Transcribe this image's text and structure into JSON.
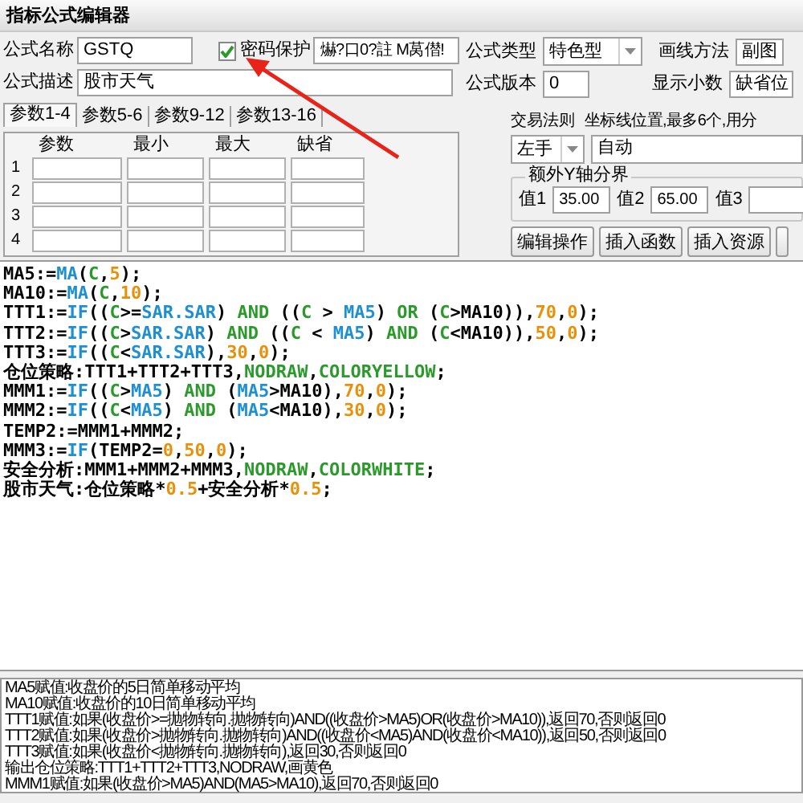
{
  "window": {
    "title": "指标公式编辑器"
  },
  "form": {
    "name_label": "公式名称",
    "name_value": "GSTQ",
    "password": {
      "label": "密码保护",
      "checked": true,
      "value": "爀?口0?註 M莴僣!"
    },
    "type_label": "公式类型",
    "type_value": "特色型",
    "draw_label": "画线方法",
    "draw_value": "副图",
    "desc_label": "公式描述",
    "desc_value": "股市天气",
    "version_label": "公式版本",
    "version_value": "0",
    "decimals_label": "显示小数",
    "decimals_value": "缺省位"
  },
  "tabs": [
    {
      "label": "参数1-4",
      "selected": true
    },
    {
      "label": "参数5-6",
      "selected": false
    },
    {
      "label": "参数9-12",
      "selected": false
    },
    {
      "label": "参数13-16",
      "selected": false
    }
  ],
  "params": {
    "columns": [
      "参数",
      "最小",
      "最大",
      "缺省"
    ],
    "rows": [
      "1",
      "2",
      "3",
      "4"
    ]
  },
  "trade": {
    "label": "交易法则",
    "value": "左手"
  },
  "axis": {
    "label": "坐标线位置,最多6个,用分",
    "value": "自动"
  },
  "extra_y": {
    "title": "额外Y轴分界",
    "values": [
      {
        "label": "值1",
        "value": "35.00"
      },
      {
        "label": "值2",
        "value": "65.00"
      },
      {
        "label": "值3"
      }
    ]
  },
  "buttons": [
    "编辑操作",
    "插入函数",
    "插入资源"
  ],
  "code": [
    [
      {
        "kind": "t",
        "text": "MA5:="
      },
      {
        "kind": "f",
        "text": "MA"
      },
      {
        "kind": "t",
        "text": "("
      },
      {
        "kind": "k",
        "text": "C"
      },
      {
        "kind": "t",
        "text": ","
      },
      {
        "kind": "n",
        "text": "5"
      },
      {
        "kind": "t",
        "text": ");"
      }
    ],
    [
      {
        "kind": "t",
        "text": "MA10:="
      },
      {
        "kind": "f",
        "text": "MA"
      },
      {
        "kind": "t",
        "text": "("
      },
      {
        "kind": "k",
        "text": "C"
      },
      {
        "kind": "t",
        "text": ","
      },
      {
        "kind": "n",
        "text": "10"
      },
      {
        "kind": "t",
        "text": ");"
      }
    ],
    [
      {
        "kind": "t",
        "text": "TTT1:="
      },
      {
        "kind": "f",
        "text": "IF"
      },
      {
        "kind": "t",
        "text": "(("
      },
      {
        "kind": "k",
        "text": "C"
      },
      {
        "kind": "t",
        "text": ">="
      },
      {
        "kind": "f",
        "text": "SAR.SAR"
      },
      {
        "kind": "t",
        "text": ") "
      },
      {
        "kind": "k",
        "text": "AND"
      },
      {
        "kind": "t",
        "text": " (("
      },
      {
        "kind": "k",
        "text": "C"
      },
      {
        "kind": "t",
        "text": " > "
      },
      {
        "kind": "f",
        "text": "MA5"
      },
      {
        "kind": "t",
        "text": ") "
      },
      {
        "kind": "k",
        "text": "OR"
      },
      {
        "kind": "t",
        "text": " ("
      },
      {
        "kind": "k",
        "text": "C"
      },
      {
        "kind": "t",
        "text": ">MA10)),"
      },
      {
        "kind": "n",
        "text": "70"
      },
      {
        "kind": "t",
        "text": ","
      },
      {
        "kind": "n",
        "text": "0"
      },
      {
        "kind": "t",
        "text": ");"
      }
    ],
    [
      {
        "kind": "t",
        "text": "TTT2:="
      },
      {
        "kind": "f",
        "text": "IF"
      },
      {
        "kind": "t",
        "text": "(("
      },
      {
        "kind": "k",
        "text": "C"
      },
      {
        "kind": "t",
        "text": ">"
      },
      {
        "kind": "f",
        "text": "SAR.SAR"
      },
      {
        "kind": "t",
        "text": ") "
      },
      {
        "kind": "k",
        "text": "AND"
      },
      {
        "kind": "t",
        "text": " (("
      },
      {
        "kind": "k",
        "text": "C"
      },
      {
        "kind": "t",
        "text": " < "
      },
      {
        "kind": "f",
        "text": "MA5"
      },
      {
        "kind": "t",
        "text": ") "
      },
      {
        "kind": "k",
        "text": "AND"
      },
      {
        "kind": "t",
        "text": " ("
      },
      {
        "kind": "k",
        "text": "C"
      },
      {
        "kind": "t",
        "text": "<MA10)),"
      },
      {
        "kind": "n",
        "text": "50"
      },
      {
        "kind": "t",
        "text": ","
      },
      {
        "kind": "n",
        "text": "0"
      },
      {
        "kind": "t",
        "text": ");"
      }
    ],
    [
      {
        "kind": "t",
        "text": "TTT3:="
      },
      {
        "kind": "f",
        "text": "IF"
      },
      {
        "kind": "t",
        "text": "(("
      },
      {
        "kind": "k",
        "text": "C"
      },
      {
        "kind": "t",
        "text": "<"
      },
      {
        "kind": "f",
        "text": "SAR.SAR"
      },
      {
        "kind": "t",
        "text": "),"
      },
      {
        "kind": "n",
        "text": "30"
      },
      {
        "kind": "t",
        "text": ","
      },
      {
        "kind": "n",
        "text": "0"
      },
      {
        "kind": "t",
        "text": ");"
      }
    ],
    [
      {
        "kind": "t",
        "text": "仓位策略:TTT1+TTT2+TTT3,"
      },
      {
        "kind": "k",
        "text": "NODRAW"
      },
      {
        "kind": "t",
        "text": ","
      },
      {
        "kind": "k",
        "text": "COLORYELLOW"
      },
      {
        "kind": "t",
        "text": ";"
      }
    ],
    [
      {
        "kind": "t",
        "text": "MMM1:="
      },
      {
        "kind": "f",
        "text": "IF"
      },
      {
        "kind": "t",
        "text": "(("
      },
      {
        "kind": "k",
        "text": "C"
      },
      {
        "kind": "t",
        "text": ">"
      },
      {
        "kind": "f",
        "text": "MA5"
      },
      {
        "kind": "t",
        "text": ") "
      },
      {
        "kind": "k",
        "text": "AND"
      },
      {
        "kind": "t",
        "text": " ("
      },
      {
        "kind": "f",
        "text": "MA5"
      },
      {
        "kind": "t",
        "text": ">MA10),"
      },
      {
        "kind": "n",
        "text": "70"
      },
      {
        "kind": "t",
        "text": ","
      },
      {
        "kind": "n",
        "text": "0"
      },
      {
        "kind": "t",
        "text": ");"
      }
    ],
    [
      {
        "kind": "t",
        "text": "MMM2:="
      },
      {
        "kind": "f",
        "text": "IF"
      },
      {
        "kind": "t",
        "text": "(("
      },
      {
        "kind": "k",
        "text": "C"
      },
      {
        "kind": "t",
        "text": "<"
      },
      {
        "kind": "f",
        "text": "MA5"
      },
      {
        "kind": "t",
        "text": ") "
      },
      {
        "kind": "k",
        "text": "AND"
      },
      {
        "kind": "t",
        "text": " ("
      },
      {
        "kind": "f",
        "text": "MA5"
      },
      {
        "kind": "t",
        "text": "<MA10),"
      },
      {
        "kind": "n",
        "text": "30"
      },
      {
        "kind": "t",
        "text": ","
      },
      {
        "kind": "n",
        "text": "0"
      },
      {
        "kind": "t",
        "text": ");"
      }
    ],
    [
      {
        "kind": "t",
        "text": "TEMP2:=MMM1+MMM2;"
      }
    ],
    [
      {
        "kind": "t",
        "text": "MMM3:="
      },
      {
        "kind": "f",
        "text": "IF"
      },
      {
        "kind": "t",
        "text": "(TEMP2="
      },
      {
        "kind": "n",
        "text": "0"
      },
      {
        "kind": "t",
        "text": ","
      },
      {
        "kind": "n",
        "text": "50"
      },
      {
        "kind": "t",
        "text": ","
      },
      {
        "kind": "n",
        "text": "0"
      },
      {
        "kind": "t",
        "text": ");"
      }
    ],
    [
      {
        "kind": "t",
        "text": "安全分析:MMM1+MMM2+MMM3,"
      },
      {
        "kind": "k",
        "text": "NODRAW"
      },
      {
        "kind": "t",
        "text": ","
      },
      {
        "kind": "k",
        "text": "COLORWHITE"
      },
      {
        "kind": "t",
        "text": ";"
      }
    ],
    [
      {
        "kind": "t",
        "text": "股市天气:仓位策略*"
      },
      {
        "kind": "n",
        "text": "0.5"
      },
      {
        "kind": "t",
        "text": "+安全分析*"
      },
      {
        "kind": "n",
        "text": "0.5"
      },
      {
        "kind": "t",
        "text": ";"
      }
    ]
  ],
  "notes": [
    "MA5赋值:收盘价的5日简单移动平均",
    "MA10赋值:收盘价的10日简单移动平均",
    "TTT1赋值:如果(收盘价>=抛物转向.抛物转向)AND((收盘价>MA5)OR(收盘价>MA10)),返回70,否则返回0",
    "TTT2赋值:如果(收盘价>抛物转向.抛物转向)AND((收盘价<MA5)AND(收盘价<MA10)),返回50,否则返回0",
    "TTT3赋值:如果(收盘价<抛物转向.抛物转向),返回30,否则返回0",
    "输出仓位策略:TTT1+TTT2+TTT3,NODRAW,画黄色",
    "MMM1赋值:如果(收盘价>MA5)AND(MA5>MA10),返回70,否则返回0"
  ]
}
